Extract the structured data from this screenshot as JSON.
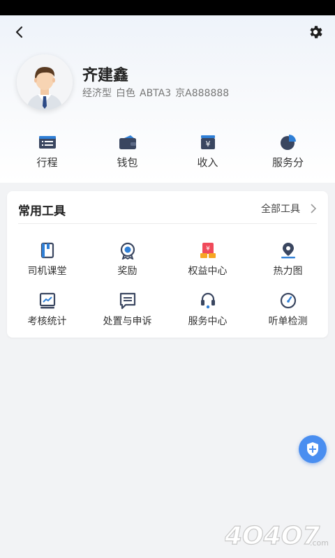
{
  "driver": {
    "name": "齐建鑫",
    "car_type": "经济型",
    "car_color": "白色",
    "car_model": "ABTA3",
    "plate": "京A888888"
  },
  "quick_actions": [
    {
      "label": "行程",
      "icon": "trip-list-icon"
    },
    {
      "label": "钱包",
      "icon": "wallet-icon"
    },
    {
      "label": "收入",
      "icon": "income-icon"
    },
    {
      "label": "服务分",
      "icon": "service-score-icon"
    }
  ],
  "tools": {
    "title": "常用工具",
    "all_label": "全部工具",
    "items": [
      {
        "label": "司机课堂",
        "icon": "driver-class-icon"
      },
      {
        "label": "奖励",
        "icon": "reward-icon"
      },
      {
        "label": "权益中心",
        "icon": "benefits-icon"
      },
      {
        "label": "热力图",
        "icon": "heatmap-icon"
      },
      {
        "label": "考核统计",
        "icon": "assessment-stats-icon"
      },
      {
        "label": "处置与申诉",
        "icon": "appeal-icon"
      },
      {
        "label": "服务中心",
        "icon": "service-center-icon"
      },
      {
        "label": "听单检测",
        "icon": "order-check-icon"
      }
    ]
  },
  "watermark": {
    "text": "4O4O7",
    "suffix": ".com"
  },
  "colors": {
    "accent": "#2f7fd6",
    "dark_icon": "#3a4660",
    "fab": "#4a8ef0",
    "red": "#f04a5a",
    "orange": "#f6a623"
  }
}
